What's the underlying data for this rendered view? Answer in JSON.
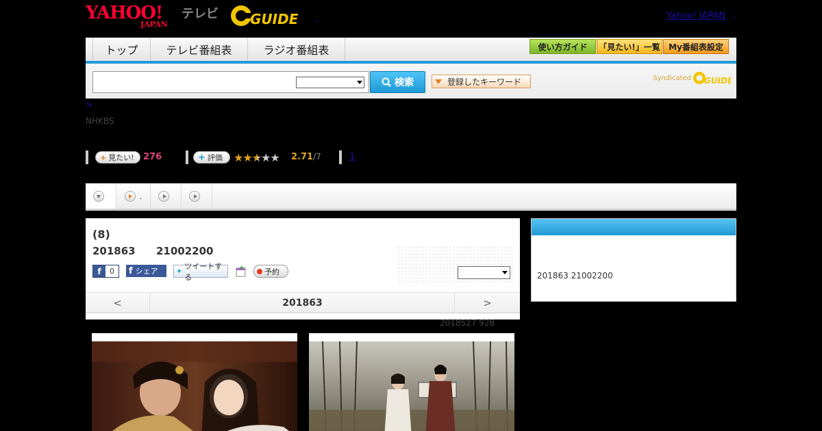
{
  "header": {
    "yahoo_logo": "YAHOO!",
    "yahoo_sub": "JAPAN",
    "tv_label": "テレビ",
    "gguide_logo": "GUIDE",
    "link_label": "Yahoo! JAPAN",
    "comma": ",",
    "trailing": "."
  },
  "nav": {
    "tabs": [
      "トップ",
      "テレビ番組表",
      "ラジオ番組表"
    ],
    "buttons": [
      "使い方ガイド",
      "「見たい!」一覧",
      "My番組表設定"
    ]
  },
  "search": {
    "placeholder": "",
    "button_label": "検索",
    "keyword_button": "登録したキーワード",
    "syndicated": "Syndicated"
  },
  "breadcrumb": ">",
  "channel": "NHKBS",
  "stats": {
    "want_label": "見たい!",
    "want_count": "276",
    "rate_label": "評価",
    "rating": "2.71",
    "rating_count": "/7",
    "rating_fraction": 0.542,
    "comments_link": "1"
  },
  "tabs": [
    {
      "label": ""
    },
    {
      "label": "."
    },
    {
      "label": ""
    },
    {
      "label": ""
    }
  ],
  "program": {
    "title": "(8)",
    "date": "201863",
    "time": "21002200",
    "fb_like": "f",
    "fb_like_count": "0",
    "fb_share": "シェア",
    "tweet": "ツイートする",
    "reserve": "予約",
    "pager_prev": "<",
    "pager_mid": "201863",
    "pager_next": ">"
  },
  "updated": "2018527  928",
  "side": {
    "schedule": "201863  21002200"
  },
  "colors": {
    "accent": "#1e9ad6",
    "yahoo_red": "#ff0033",
    "gguide_yellow": "#f2c500"
  }
}
